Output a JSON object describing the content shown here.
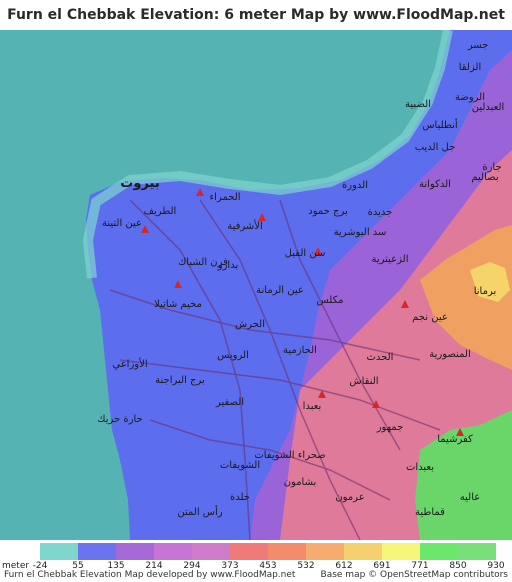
{
  "title": "Furn el Chebbak Elevation: 6 meter Map by www.FloodMap.net (beta)",
  "map": {
    "colors": {
      "sea": "#55b3b4",
      "low": "#5c6dee",
      "mid": "#9a64d8",
      "hill": "#e07a9a",
      "high": "#f0a060",
      "peak": "#f5d46a",
      "green": "#6ad66a",
      "marker": "#d22a2a"
    },
    "places": [
      {
        "id": "beirut",
        "label": "بيروت"
      },
      {
        "id": "jisr",
        "label": "جسر"
      },
      {
        "id": "zalqa",
        "label": "الزلقا"
      },
      {
        "id": "jal-el-dib",
        "label": "جل الديب"
      },
      {
        "id": "atlas",
        "label": "أنطلياس"
      },
      {
        "id": "rawda",
        "label": "الروضة"
      },
      {
        "id": "abdine",
        "label": "العبدلين"
      },
      {
        "id": "jara",
        "label": "جارة"
      },
      {
        "id": "bsalim",
        "label": "بصاليم"
      },
      {
        "id": "dibayeh",
        "label": "الضبية"
      },
      {
        "id": "dekwaneh",
        "label": "الدكوانة"
      },
      {
        "id": "hamra",
        "label": "الحمراء"
      },
      {
        "id": "tarik",
        "label": "الطريف"
      },
      {
        "id": "ain-tineh",
        "label": "عين التينة"
      },
      {
        "id": "achrafieh",
        "label": "الأشرفية"
      },
      {
        "id": "jdeideh",
        "label": "جديدة"
      },
      {
        "id": "sin-el-fil",
        "label": "سن الفيل"
      },
      {
        "id": "dora",
        "label": "الدورة"
      },
      {
        "id": "burj-hammoud",
        "label": "برج حمود"
      },
      {
        "id": "sad",
        "label": "سد البوشرية"
      },
      {
        "id": "zaaitrieh",
        "label": "الزعيترية"
      },
      {
        "id": "mkalles",
        "label": "مكلس"
      },
      {
        "id": "badaro",
        "label": "بدارو"
      },
      {
        "id": "furn",
        "label": "فرن الشباك"
      },
      {
        "id": "ain-rumaneh",
        "label": "عين الرمانة"
      },
      {
        "id": "chatila",
        "label": "مخيم شاتيلا"
      },
      {
        "id": "horsh",
        "label": "الحرش"
      },
      {
        "id": "ouzai",
        "label": "الأوزاعي"
      },
      {
        "id": "ruweis",
        "label": "الرويس"
      },
      {
        "id": "burj-barajneh",
        "label": "برج البراجنة"
      },
      {
        "id": "sfeir",
        "label": "الصفير"
      },
      {
        "id": "harik",
        "label": "حارة حريك"
      },
      {
        "id": "jamhour",
        "label": "جمهور"
      },
      {
        "id": "baabda",
        "label": "بعبدا"
      },
      {
        "id": "naccache",
        "label": "النقاش"
      },
      {
        "id": "hazmieh",
        "label": "الحازمية"
      },
      {
        "id": "hadath",
        "label": "الحدث"
      },
      {
        "id": "mansourieh",
        "label": "المنصورية"
      },
      {
        "id": "ain-najm",
        "label": "عين نجم"
      },
      {
        "id": "brummana",
        "label": "برمانا"
      },
      {
        "id": "kfarshima",
        "label": "كفرشيما"
      },
      {
        "id": "shwayfat",
        "label": "الشويفات"
      },
      {
        "id": "choueifat-b",
        "label": "صحراء الشويفات"
      },
      {
        "id": "aley",
        "label": "عاليه"
      },
      {
        "id": "bchamoun",
        "label": "بشامون"
      },
      {
        "id": "khaldeh",
        "label": "خلدة"
      },
      {
        "id": "ras-el-matn",
        "label": "رأس المتن"
      },
      {
        "id": "aramoun",
        "label": "عرمون"
      },
      {
        "id": "baabdat",
        "label": "بعبدات"
      },
      {
        "id": "qmatiyeh",
        "label": "قماطية"
      }
    ]
  },
  "legend": {
    "unit": "meter",
    "values": [
      "-24",
      "55",
      "135",
      "214",
      "294",
      "373",
      "453",
      "532",
      "612",
      "691",
      "771",
      "850",
      "930"
    ],
    "colors": [
      "#7fd6cf",
      "#6b74ee",
      "#a56ad8",
      "#c874d6",
      "#d07ccb",
      "#f07a7a",
      "#f58b6b",
      "#f5ac6e",
      "#f5d06e",
      "#f5f57a",
      "#6be86b",
      "#7ade7a"
    ]
  },
  "footer": {
    "left": "Furn el Chebbak Elevation Map developed by www.FloodMap.net",
    "right": "Base map © OpenStreetMap contributors"
  }
}
